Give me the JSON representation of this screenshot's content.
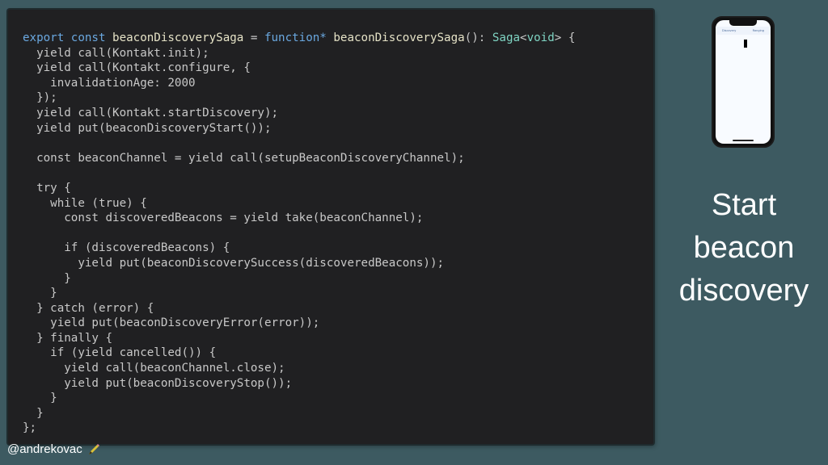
{
  "code": {
    "lines": [
      [
        {
          "t": "export const ",
          "c": "kw"
        },
        {
          "t": "beaconDiscoverySaga",
          "c": "fn"
        },
        {
          "t": " = ",
          "c": ""
        },
        {
          "t": "function*",
          "c": "kw"
        },
        {
          "t": " beaconDiscoverySaga",
          "c": "fn"
        },
        {
          "t": "(): ",
          "c": ""
        },
        {
          "t": "Saga",
          "c": "ty"
        },
        {
          "t": "<",
          "c": ""
        },
        {
          "t": "void",
          "c": "ty"
        },
        {
          "t": "> {",
          "c": ""
        }
      ],
      [
        {
          "t": "  yield call(Kontakt.init);",
          "c": ""
        }
      ],
      [
        {
          "t": "  yield call(Kontakt.configure, {",
          "c": ""
        }
      ],
      [
        {
          "t": "    invalidationAge: 2000",
          "c": ""
        }
      ],
      [
        {
          "t": "  });",
          "c": ""
        }
      ],
      [
        {
          "t": "  yield call(Kontakt.startDiscovery);",
          "c": ""
        }
      ],
      [
        {
          "t": "  yield put(beaconDiscoveryStart());",
          "c": ""
        }
      ],
      [
        {
          "t": "",
          "c": ""
        }
      ],
      [
        {
          "t": "  const beaconChannel = yield call(setupBeaconDiscoveryChannel);",
          "c": ""
        }
      ],
      [
        {
          "t": "",
          "c": ""
        }
      ],
      [
        {
          "t": "  try {",
          "c": ""
        }
      ],
      [
        {
          "t": "    while (true) {",
          "c": ""
        }
      ],
      [
        {
          "t": "      const discoveredBeacons = yield take(beaconChannel);",
          "c": ""
        }
      ],
      [
        {
          "t": "",
          "c": ""
        }
      ],
      [
        {
          "t": "      if (discoveredBeacons) {",
          "c": ""
        }
      ],
      [
        {
          "t": "        yield put(beaconDiscoverySuccess(discoveredBeacons));",
          "c": ""
        }
      ],
      [
        {
          "t": "      }",
          "c": ""
        }
      ],
      [
        {
          "t": "    }",
          "c": ""
        }
      ],
      [
        {
          "t": "  } catch (error) {",
          "c": ""
        }
      ],
      [
        {
          "t": "    yield put(beaconDiscoveryError(error));",
          "c": ""
        }
      ],
      [
        {
          "t": "  } finally {",
          "c": ""
        }
      ],
      [
        {
          "t": "    if (yield cancelled()) {",
          "c": ""
        }
      ],
      [
        {
          "t": "      yield call(beaconChannel.close);",
          "c": ""
        }
      ],
      [
        {
          "t": "      yield put(beaconDiscoveryStop());",
          "c": ""
        }
      ],
      [
        {
          "t": "    }",
          "c": ""
        }
      ],
      [
        {
          "t": "  }",
          "c": ""
        }
      ],
      [
        {
          "t": "};",
          "c": ""
        }
      ]
    ]
  },
  "phone": {
    "header_left": "Discovery",
    "header_right": "Ranging"
  },
  "caption": {
    "line1": "Start",
    "line2": "beacon",
    "line3": "discovery"
  },
  "footer": {
    "author": "@andrekovac",
    "icon": "pen-icon"
  },
  "colors": {
    "background": "#3d5a61",
    "code_bg": "#202022",
    "keyword": "#6aa8e0",
    "function_name": "#e6e3c7",
    "type": "#7fd4c3",
    "code_text": "#c8c8c8"
  }
}
